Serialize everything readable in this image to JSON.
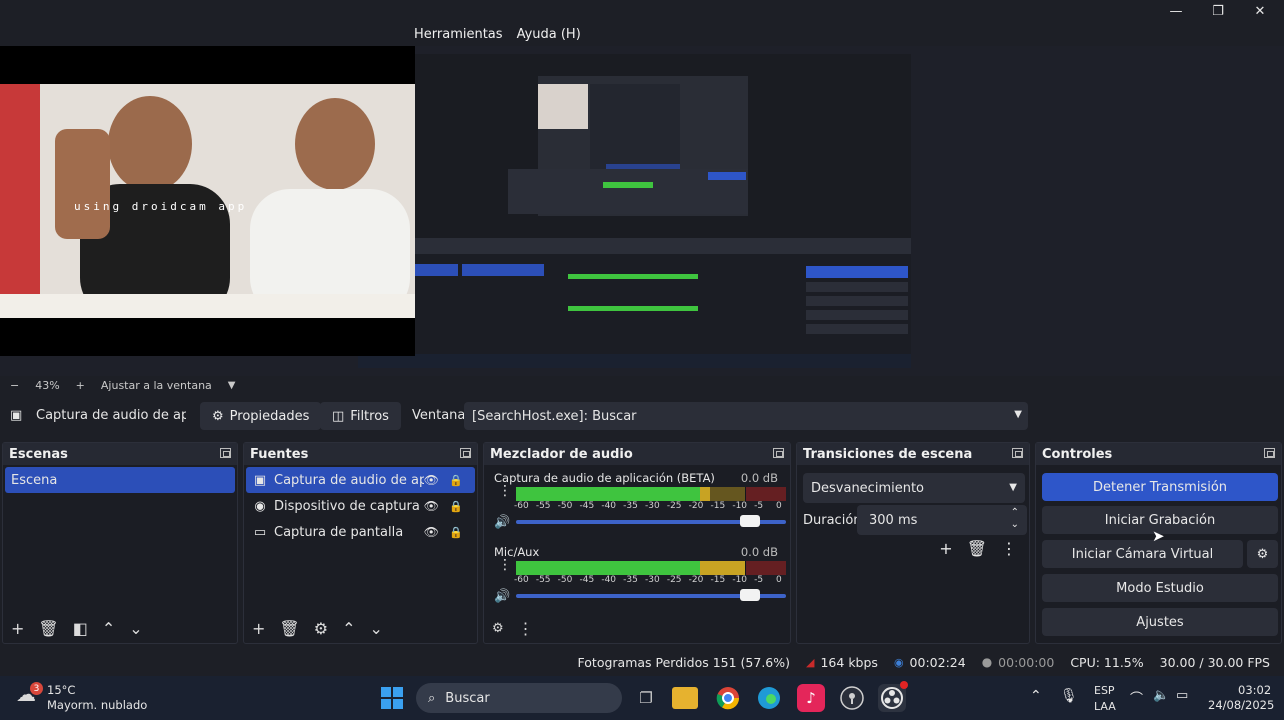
{
  "window": {
    "minimize": "—",
    "restore": "❐",
    "close": "✕"
  },
  "menu": [
    "Herramientas",
    "Ayuda (H)"
  ],
  "camera": {
    "watermark": "using droidcam app"
  },
  "zoom": {
    "minus": "−",
    "level": "43%",
    "plus": "+",
    "fit": "Ajustar a la ventana"
  },
  "source_toolbar": {
    "source_name": "Captura de audio de aplica",
    "properties": "Propiedades",
    "filters": "Filtros",
    "window_label": "Ventana",
    "window_value": "[SearchHost.exe]: Buscar"
  },
  "scenes": {
    "title": "Escenas",
    "items": [
      "Escena"
    ]
  },
  "sources": {
    "title": "Fuentes",
    "items": [
      {
        "label": "Captura de audio de aplica",
        "icon": "app-audio-icon"
      },
      {
        "label": "Dispositivo de captura de v",
        "icon": "camera-icon"
      },
      {
        "label": "Captura de pantalla",
        "icon": "monitor-icon"
      }
    ]
  },
  "mixer": {
    "title": "Mezclador de audio",
    "channels": [
      {
        "name": "Captura de audio de aplicación (BETA)",
        "db": "0.0 dB",
        "level": 0.72
      },
      {
        "name": "Mic/Aux",
        "db": "0.0 dB",
        "level": 0.85
      }
    ],
    "ticks": [
      "-60",
      "-55",
      "-50",
      "-45",
      "-40",
      "-35",
      "-30",
      "-25",
      "-20",
      "-15",
      "-10",
      "-5",
      "0"
    ]
  },
  "transitions": {
    "title": "Transiciones de escena",
    "selected": "Desvanecimiento",
    "duration_label": "Duración",
    "duration_value": "300 ms"
  },
  "controls": {
    "title": "Controles",
    "stop_stream": "Detener Transmisión",
    "start_record": "Iniciar Grabación",
    "virtual_cam": "Iniciar Cámara Virtual",
    "studio_mode": "Modo Estudio",
    "settings": "Ajustes"
  },
  "status": {
    "dropped_frames": "Fotogramas Perdidos 151 (57.6%)",
    "bitrate": "164 kbps",
    "stream_time": "00:02:24",
    "record_time": "00:00:00",
    "cpu": "CPU: 11.5%",
    "fps": "30.00 / 30.00 FPS"
  },
  "taskbar": {
    "weather_temp": "15°C",
    "weather_desc": "Mayorm. nublado",
    "weather_badge": "3",
    "search": "Buscar",
    "lang_1": "ESP",
    "lang_2": "LAA",
    "time": "03:02",
    "date": "24/08/2025"
  },
  "colors": {
    "accent": "#2e56c9",
    "meter_green": "#3fc43f",
    "meter_yellow": "#c8a323",
    "meter_red": "#c82a2a"
  }
}
